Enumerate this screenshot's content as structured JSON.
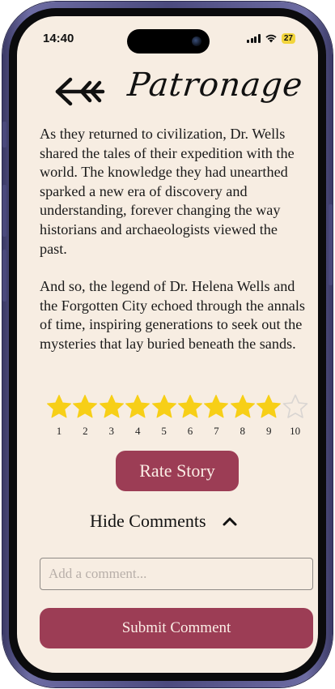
{
  "status_bar": {
    "time": "14:40",
    "battery": "27",
    "battery_color": "#f2d53c"
  },
  "header": {
    "back_icon": "double-arrow-left-icon",
    "title": "Patronage"
  },
  "story": {
    "paragraphs": [
      "As they returned to civilization, Dr. Wells shared the tales of their expedition with the world. The knowledge they had unearthed sparked a new era of discovery and understanding, forever changing the way historians and archaeologists viewed the past.",
      "And so, the legend of Dr. Helena Wells and the Forgotten City echoed through the annals of time, inspiring generations to seek out the mysteries that lay buried beneath the sands."
    ]
  },
  "rating": {
    "max": 10,
    "selected": 9,
    "labels": [
      "1",
      "2",
      "3",
      "4",
      "5",
      "6",
      "7",
      "8",
      "9",
      "10"
    ],
    "filled_color": "#f7cf17",
    "empty_color": "#d9d5d2"
  },
  "rate_button": {
    "label": "Rate Story"
  },
  "comments_toggle": {
    "label": "Hide Comments",
    "icon": "chevron-up-icon"
  },
  "comment_input": {
    "placeholder": "Add a comment...",
    "value": ""
  },
  "submit_button": {
    "label": "Submit Comment"
  },
  "colors": {
    "background": "#f7ede2",
    "accent": "#9c3d55",
    "accent_text": "#fbeee6"
  }
}
